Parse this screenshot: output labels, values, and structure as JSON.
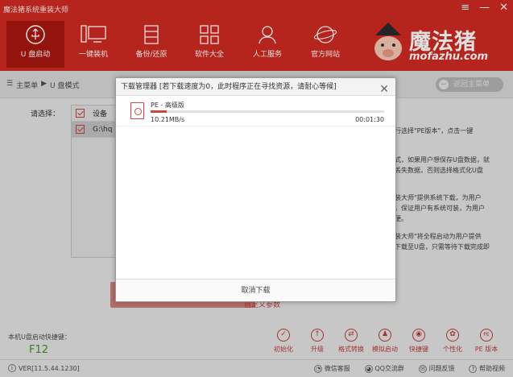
{
  "window": {
    "title": "魔法猪系统重装大师",
    "menu_icon": "≡",
    "minimize_icon": "—",
    "close_icon": "✕"
  },
  "nav": [
    {
      "label": "U 盘启动",
      "icon": "usb-icon",
      "active": true
    },
    {
      "label": "一键装机",
      "icon": "monitor-icon",
      "active": false
    },
    {
      "label": "备份/还原",
      "icon": "backup-icon",
      "active": false
    },
    {
      "label": "软件大全",
      "icon": "apps-grid-icon",
      "active": false
    },
    {
      "label": "人工服务",
      "icon": "person-icon",
      "active": false
    },
    {
      "label": "官方网站",
      "icon": "globe-icon",
      "active": false
    }
  ],
  "brand": {
    "name": "魔法猪",
    "domain": "mofazhu.com"
  },
  "breadcrumb": {
    "icon": "☰",
    "home": "主菜单",
    "sep": "▶",
    "current": "U 盘模式"
  },
  "back_button": {
    "label": "返回主菜单",
    "icon": "↩"
  },
  "main": {
    "select_label": "请选择：",
    "device_rows": [
      "设备",
      "G:\\hq"
    ],
    "side_lines_1": [
      "行选择\"PE版本\"，点击一键"
    ],
    "side_lines_2": [
      "式，如果用户想保存U盘数据，就",
      "丢失数据，否则选择格式化U盘"
    ],
    "side_lines_3": [
      "装大师\"提供系统下载，为用户",
      "，保证用户有系统可装，为用户",
      "便。"
    ],
    "side_lines_4": [
      "装大师\"将全程启动为用户提供",
      "下载至U盘，只需等待下载完成即"
    ],
    "advanced_link": "自定义参数",
    "hotkey_label": "本机U盘启动快捷键：",
    "hotkey_value": "F12"
  },
  "tools": [
    {
      "label": "初始化",
      "icon": "check-icon",
      "glyph": "✓"
    },
    {
      "label": "升级",
      "icon": "upgrade-icon",
      "glyph": "↑"
    },
    {
      "label": "格式转换",
      "icon": "convert-icon",
      "glyph": "⇄"
    },
    {
      "label": "模拟启动",
      "icon": "simulate-icon",
      "glyph": "♟"
    },
    {
      "label": "快捷键",
      "icon": "mouse-icon",
      "glyph": "◉"
    },
    {
      "label": "个性化",
      "icon": "brush-icon",
      "glyph": "✿"
    },
    {
      "label": "PE 版本",
      "icon": "pe-icon",
      "glyph": "PE"
    }
  ],
  "status_bar": {
    "version": "VER[11.5.44.1230]",
    "links": [
      {
        "label": "微信客服",
        "icon": "wechat-icon",
        "glyph": "◔"
      },
      {
        "label": "QQ交流群",
        "icon": "qq-icon",
        "glyph": "◕"
      },
      {
        "label": "问题反馈",
        "icon": "feedback-icon",
        "glyph": "✉"
      },
      {
        "label": "帮助视频",
        "icon": "help-icon",
        "glyph": "?"
      }
    ]
  },
  "dialog": {
    "title": "下载管理器 [若下载速度为0，此时程序正在寻找资源，请耐心等候]",
    "close": "✕",
    "item": {
      "name": "PE - 高级版",
      "speed": "10.21MB/s",
      "elapsed": "00:01:30",
      "progress": 0.07
    },
    "cancel_label": "取消下载"
  },
  "colors": {
    "brand_red": "#cf2a22",
    "active_nav": "#a9170f",
    "accent": "#d0453d",
    "hotkey_green": "#46a632"
  }
}
